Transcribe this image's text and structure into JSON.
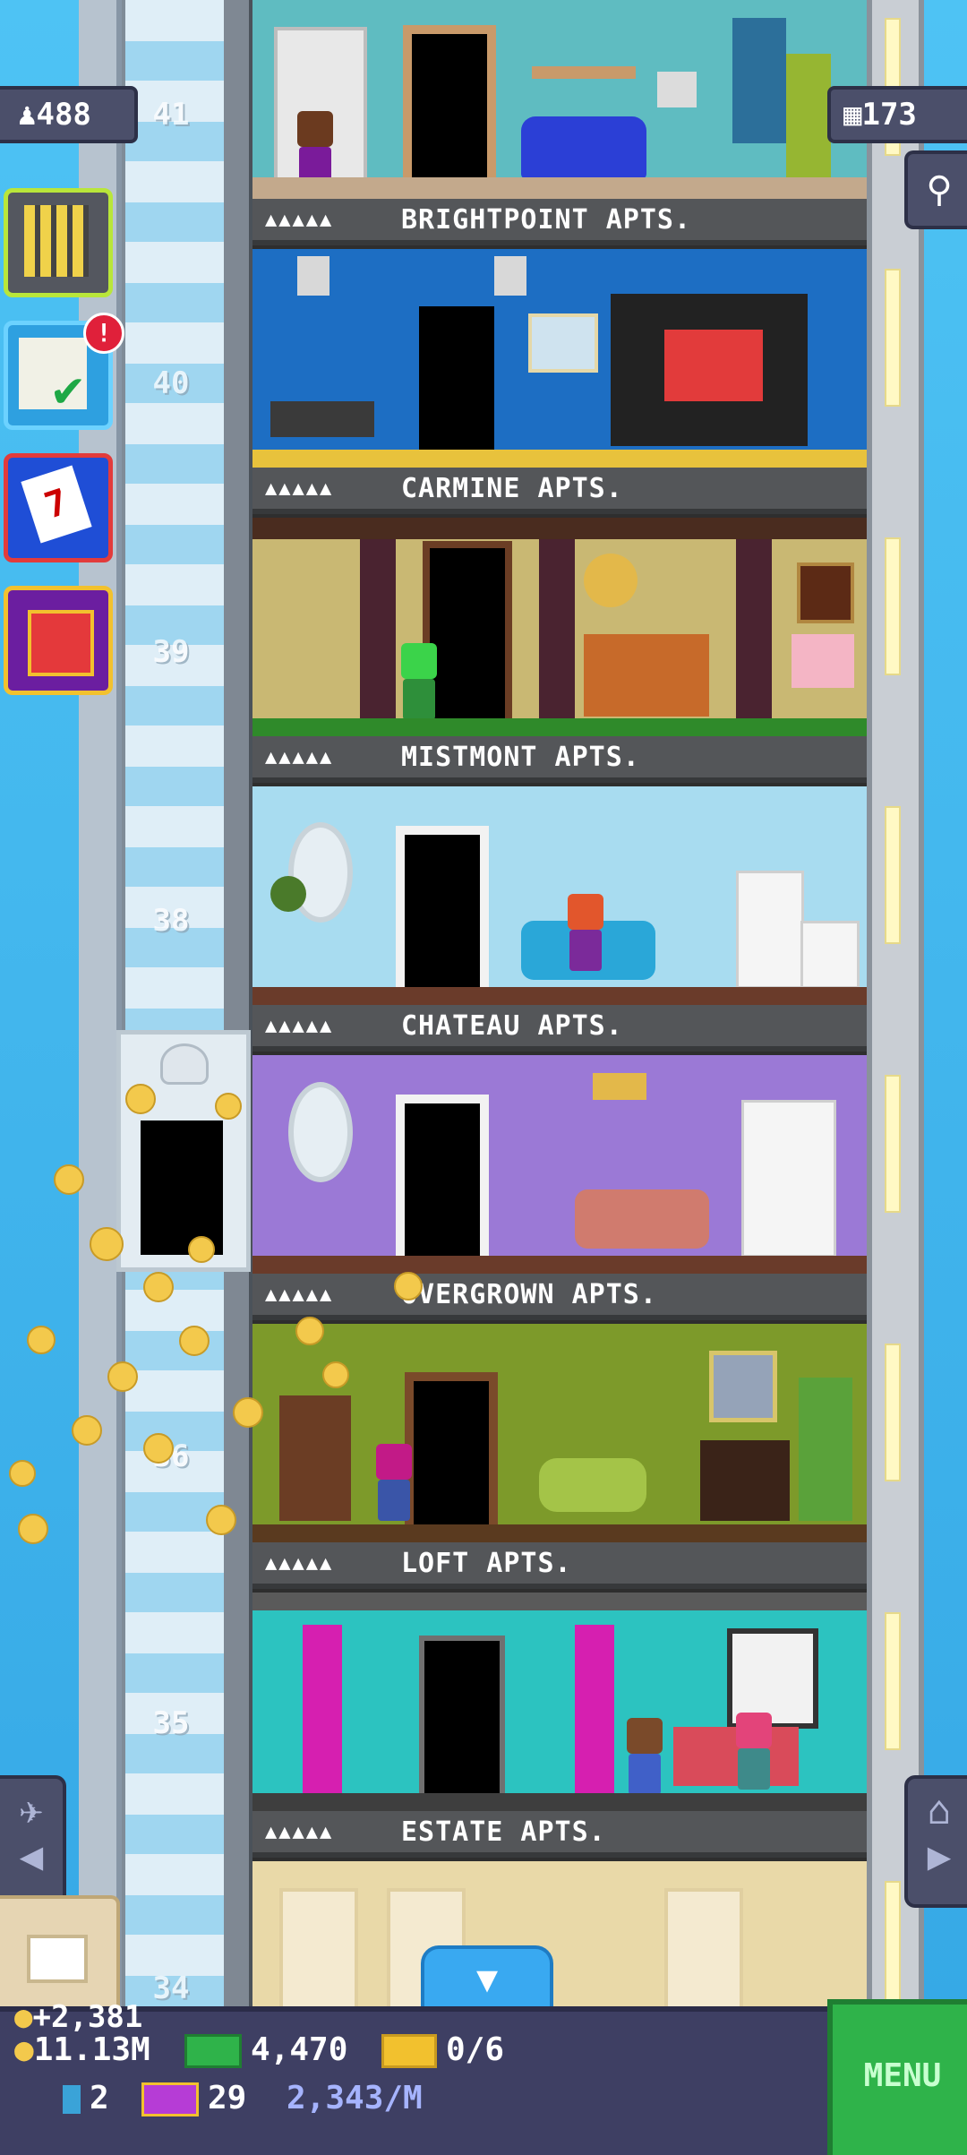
{
  "stats": {
    "population": "488",
    "floors_built": "173"
  },
  "elevator": {
    "floor_numbers": [
      "41",
      "40",
      "39",
      "38",
      "36",
      "35",
      "34"
    ]
  },
  "floors": [
    {
      "name": "BRIGHTPOINT APTS.",
      "stars": "▲▲▲▲▲",
      "wall_color": "#5fbcc1"
    },
    {
      "name": "CARMINE APTS.",
      "stars": "▲▲▲▲▲",
      "wall_color": "#1d6ec3"
    },
    {
      "name": "MISTMONT APTS.",
      "stars": "▲▲▲▲▲",
      "wall_color": "#c9b873"
    },
    {
      "name": "CHATEAU APTS.",
      "stars": "▲▲▲▲▲",
      "wall_color": "#a8dcf0"
    },
    {
      "name": "OVERGROWN APTS.",
      "stars": "▲▲▲▲▲",
      "wall_color": "#9b79d6"
    },
    {
      "name": "LOFT APTS.",
      "stars": "▲▲▲▲▲",
      "wall_color": "#7d9a2a"
    },
    {
      "name": "ESTATE APTS.",
      "stars": "▲▲▲▲▲",
      "wall_color": "#2cc3c0"
    }
  ],
  "sidebar": {
    "notification_badge": "!",
    "calendar_day": "7"
  },
  "hud": {
    "coin_gain": "+2,381",
    "coins": "11.13M",
    "bux": "4,470",
    "vip_slots": "0/6",
    "elevator_count": "2",
    "tower_bux": "29",
    "income_rate": "2,343/M",
    "menu_label": "MENU"
  },
  "colors": {
    "accent_green": "#2fb34a",
    "hud_bg": "#3e3f63",
    "label_bar": "#545659"
  }
}
